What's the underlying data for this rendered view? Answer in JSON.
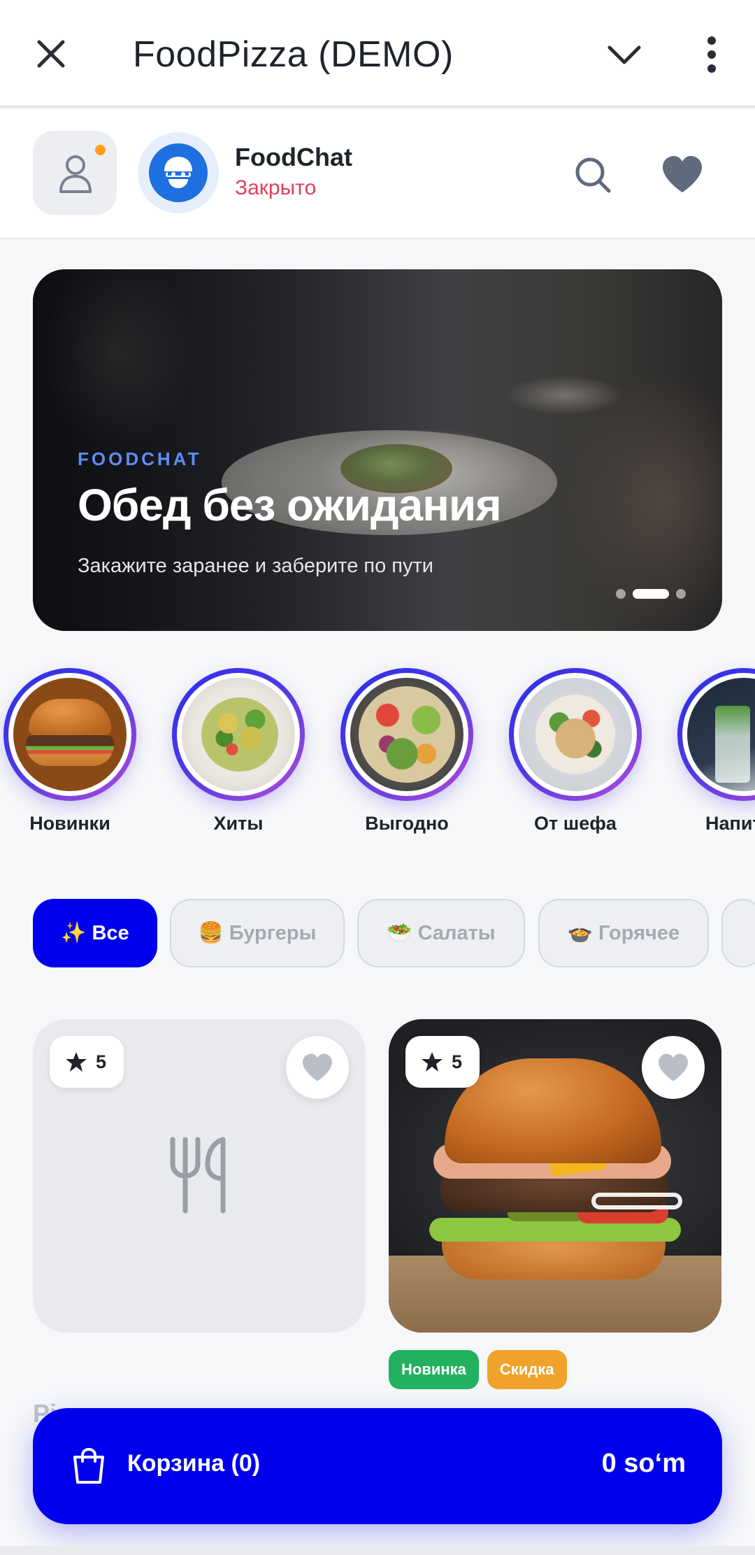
{
  "topbar": {
    "title": "FoodPizza (DEMO)",
    "close_icon": "close-icon",
    "chevron_icon": "chevron-down-icon",
    "more_icon": "more-vertical-icon"
  },
  "header": {
    "brand_name": "FoodChat",
    "status": "Закрыто",
    "status_color": "#e0405a",
    "notification_dot_color": "#ff9f1a"
  },
  "banner": {
    "eyebrow": "FOODCHAT",
    "title": "Обед без ожидания",
    "subtitle": "Закажите заранее и заберите по пути",
    "slides": 3,
    "active_slide": 2
  },
  "stories": [
    {
      "label": "Новинки",
      "image": "burger"
    },
    {
      "label": "Хиты",
      "image": "pasta-salad"
    },
    {
      "label": "Выгодно",
      "image": "veggie-bowl"
    },
    {
      "label": "От шефа",
      "image": "chef-plate"
    },
    {
      "label": "Напит",
      "image": "drinks"
    }
  ],
  "chips": [
    {
      "label": "✨ Все",
      "active": true
    },
    {
      "label": "🍔 Бургеры",
      "active": false
    },
    {
      "label": "🥗 Салаты",
      "active": false
    },
    {
      "label": "🍲 Горячее",
      "active": false
    },
    {
      "label": "",
      "active": false
    }
  ],
  "products": [
    {
      "rating": "5",
      "image": "placeholder-fork-knife",
      "favorite": false,
      "name_peek": "Pi"
    },
    {
      "rating": "5",
      "image": "burger",
      "favorite": false,
      "badges": [
        "Новинка",
        "Скидка"
      ]
    }
  ],
  "cart": {
    "label": "Корзина (0)",
    "total": "0 so‘m"
  },
  "colors": {
    "accent": "#0000ee",
    "badge_new": "#22b15f",
    "badge_discount": "#f0a22a",
    "banner_eyebrow": "#5d8df5"
  }
}
